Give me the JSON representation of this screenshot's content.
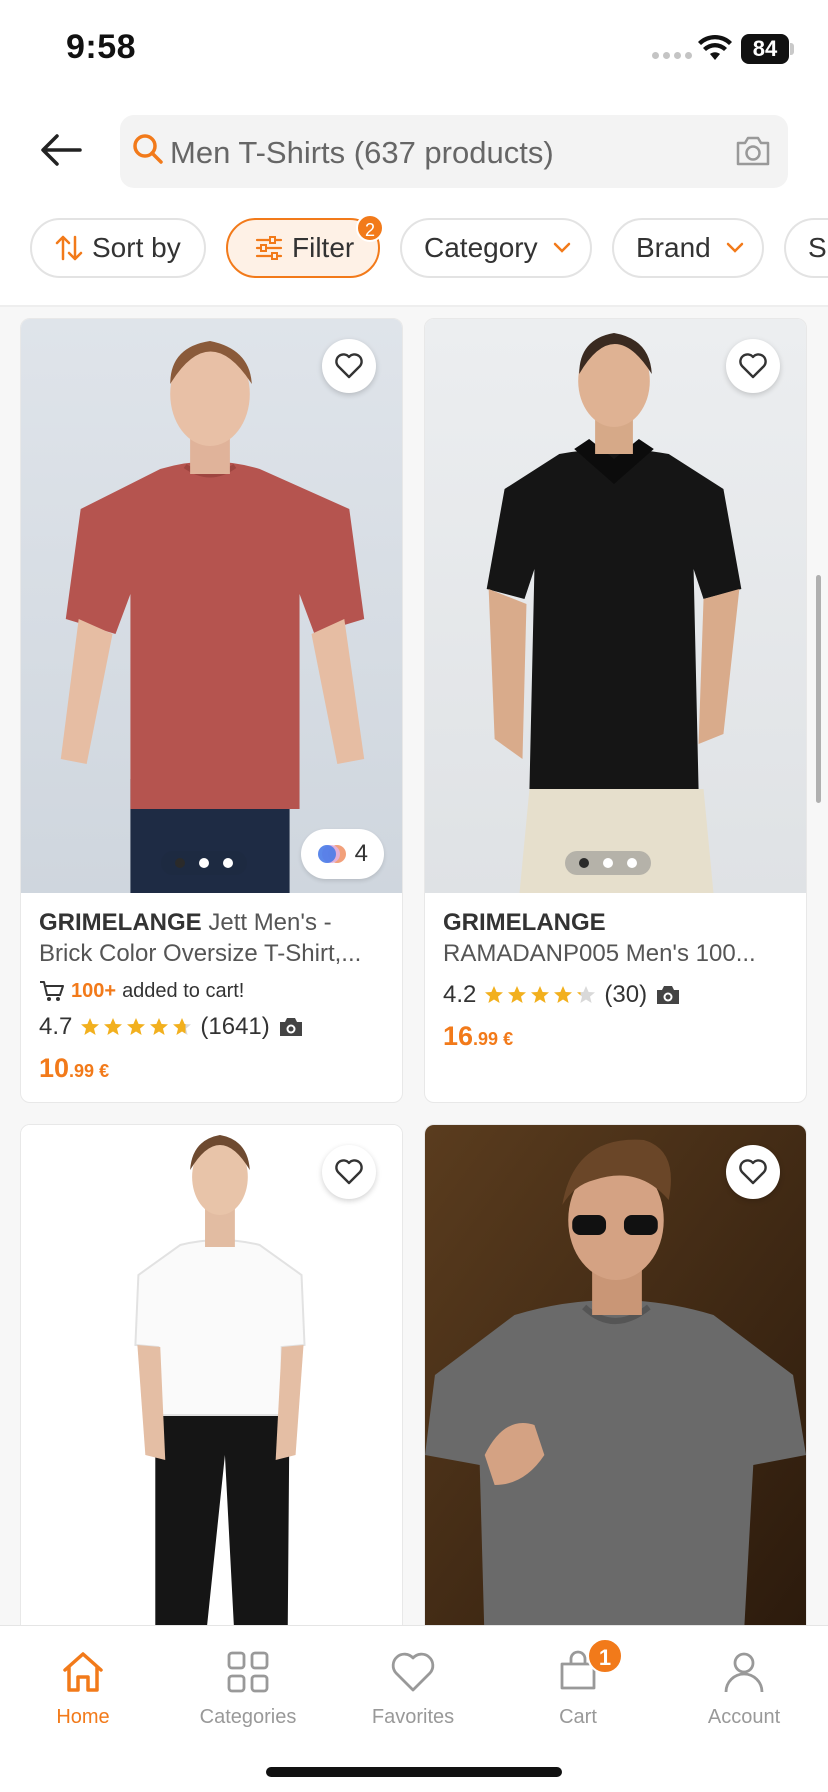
{
  "status_bar": {
    "time": "9:58",
    "battery": "84"
  },
  "search": {
    "text": "Men T-Shirts (637 products)"
  },
  "chips": {
    "sort": "Sort by",
    "filter": "Filter",
    "filter_count": "2",
    "category": "Category",
    "brand": "Brand",
    "size": "Si"
  },
  "products": [
    {
      "brand": "GRIMELANGE",
      "name": " Jett Men's -",
      "name2": "Brick Color Oversize T-Shirt,...",
      "cart_count": "100+",
      "cart_text": "added to cart!",
      "rating": "4.7",
      "stars": 4.7,
      "reviews": "(1641)",
      "price_main": "10",
      "price_cents": ".99 €",
      "variants": "4"
    },
    {
      "brand": "GRIMELANGE",
      "name2": "RAMADANP005 Men's 100...",
      "rating": "4.2",
      "stars": 4.2,
      "reviews": "(30)",
      "price_main": "16",
      "price_cents": ".99 €"
    }
  ],
  "nav": {
    "home": "Home",
    "categories": "Categories",
    "favorites": "Favorites",
    "cart": "Cart",
    "cart_count": "1",
    "account": "Account"
  },
  "colors": {
    "accent": "#f27a1a",
    "text": "#333333",
    "star": "#f2b01e"
  }
}
